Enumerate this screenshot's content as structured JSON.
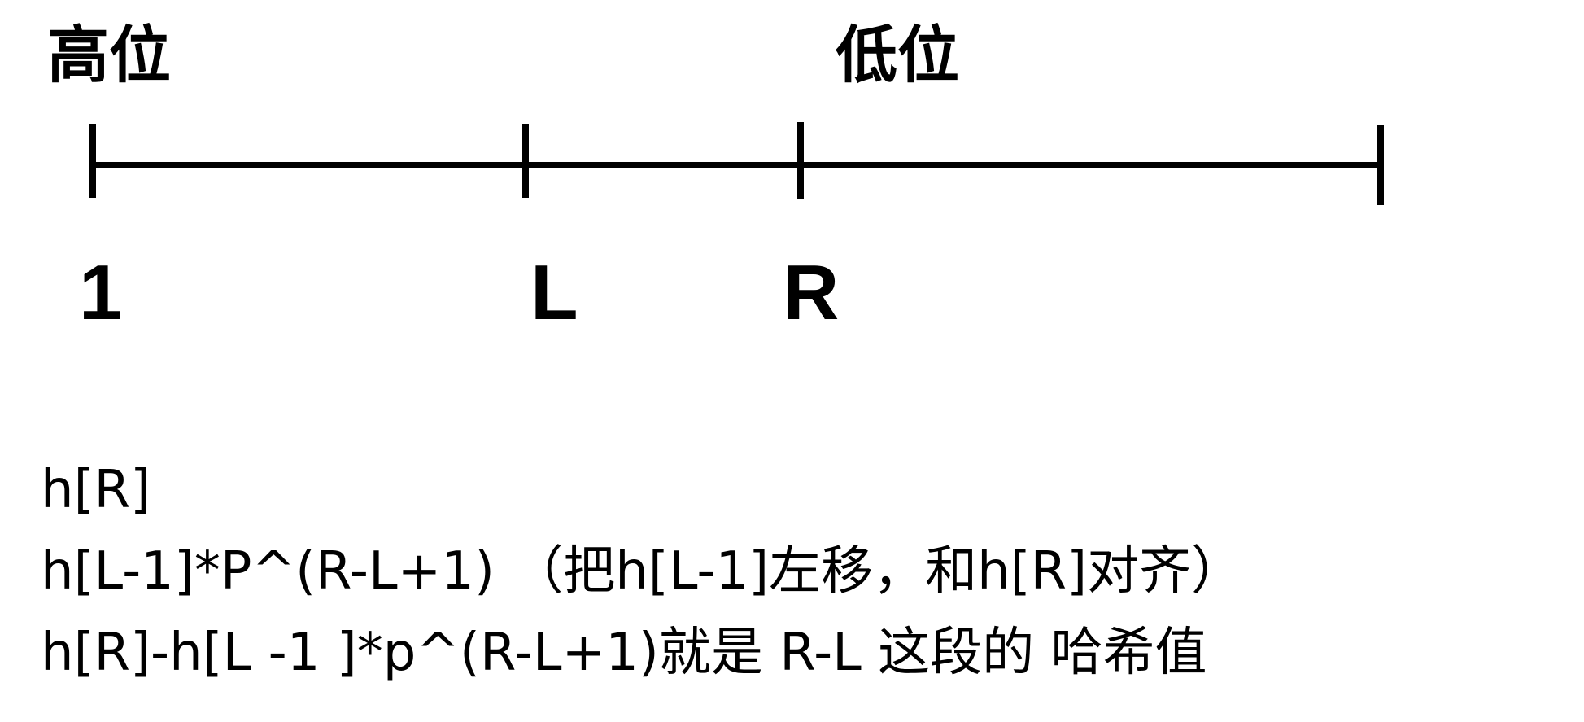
{
  "labels": {
    "high": "高位",
    "low": "低位"
  },
  "axis": {
    "ticks": [
      "1",
      "L",
      "R"
    ]
  },
  "formulas": [
    "h[R]",
    "h[L-1]*P^(R-L+1) （把h[L-1]左移，和h[R]对齐）",
    "h[R]-h[L -1 ]*p^(R-L+1)就是 R-L 这段的 哈希值"
  ],
  "colors": {
    "line": "#000000",
    "text": "#000000",
    "background": "#ffffff"
  }
}
